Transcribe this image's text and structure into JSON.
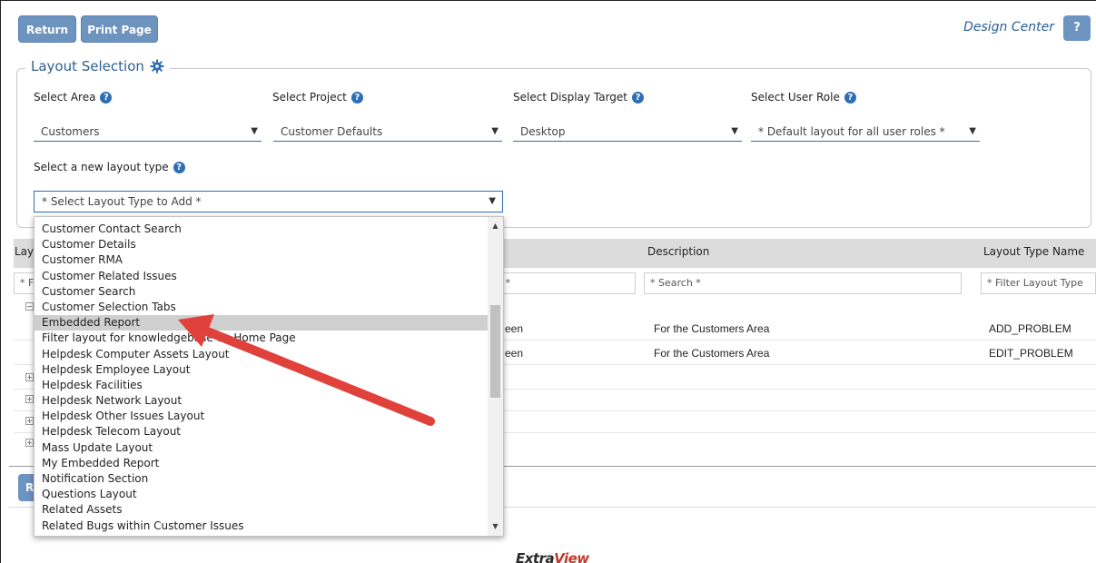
{
  "toolbar": {
    "return_label": "Return",
    "print_label": "Print Page",
    "design_center": "Design Center",
    "help_label": "?"
  },
  "layout_selection": {
    "legend": "Layout Selection",
    "area": {
      "label": "Select Area",
      "value": "Customers"
    },
    "project": {
      "label": "Select Project",
      "value": "Customer Defaults"
    },
    "display_target": {
      "label": "Select Display Target",
      "value": "Desktop"
    },
    "user_role": {
      "label": "Select User Role",
      "value": "* Default layout for all user roles *"
    },
    "new_layout_type": {
      "label": "Select a new layout type",
      "value": "* Select Layout Type to Add *"
    }
  },
  "table": {
    "col_partial_1": "Lay",
    "col_description": "Description",
    "col_layout_type_name": "Layout Type Name",
    "filter_partial_1": "* F",
    "filter_partial_2": "n *",
    "filter_description": "* Search *",
    "filter_layout_type": "* Filter Layout Type",
    "rows": [
      {
        "partial": "een",
        "description": "For the Customers Area",
        "type_name": "ADD_PROBLEM"
      },
      {
        "partial": "een",
        "description": "For the Customers Area",
        "type_name": "EDIT_PROBLEM"
      }
    ],
    "partial_button": "R"
  },
  "dropdown": {
    "items": [
      "Customer Contact Search",
      "Customer Details",
      "Customer RMA",
      "Customer Related Issues",
      "Customer Search",
      "Customer Selection Tabs",
      "Embedded Report",
      "Filter layout for knowledgebase on Home Page",
      "Helpdesk Computer Assets Layout",
      "Helpdesk Employee Layout",
      "Helpdesk Facilities",
      "Helpdesk Network Layout",
      "Helpdesk Other Issues Layout",
      "Helpdesk Telecom Layout",
      "Mass Update Layout",
      "My Embedded Report",
      "Notification Section",
      "Questions Layout",
      "Related Assets",
      "Related Bugs within Customer Issues"
    ],
    "highlighted": "Embedded Report"
  },
  "footer": {
    "logo_a": "Extra",
    "logo_b": "View"
  },
  "colors": {
    "button": "#6d93bf",
    "accent": "#2c5f93",
    "annotation_arrow": "#e0413a"
  }
}
